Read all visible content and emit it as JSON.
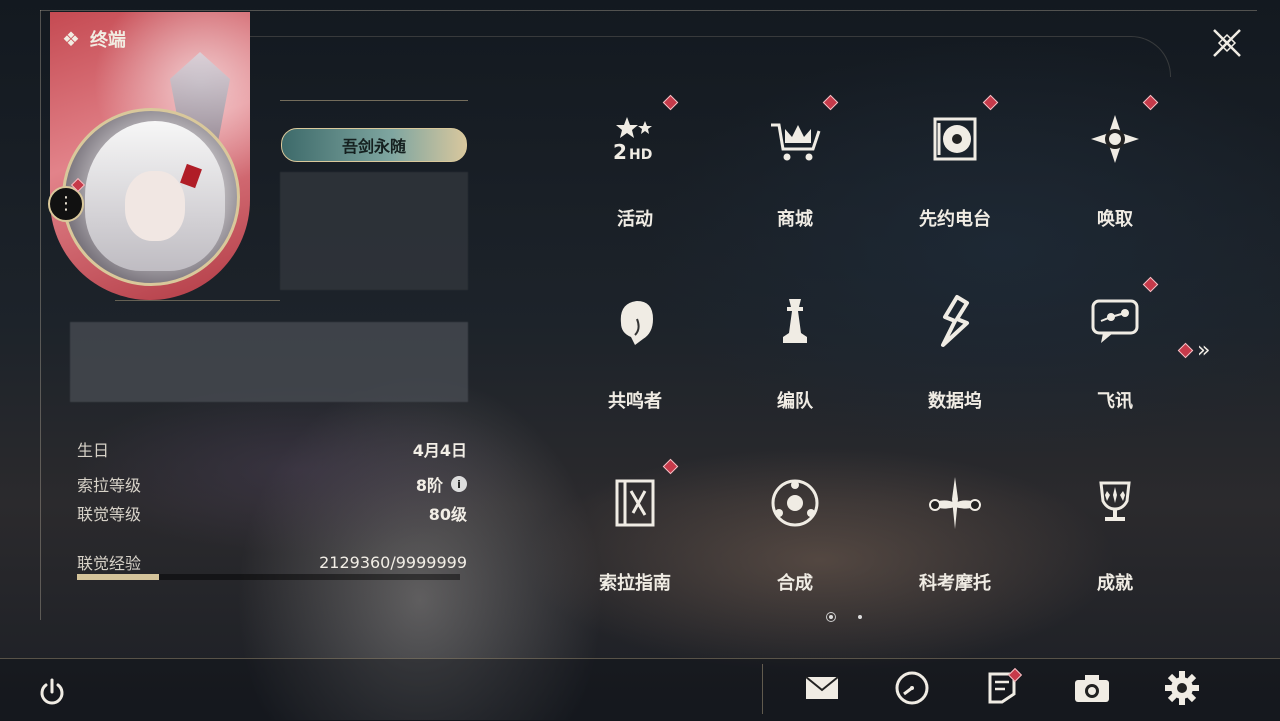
{
  "header": {
    "title": "终端"
  },
  "profile": {
    "title_badge": "吾剑永随"
  },
  "info": {
    "birthday": {
      "label": "生日",
      "value": "4月4日"
    },
    "sola_level": {
      "label": "索拉等级",
      "value": "8阶"
    },
    "union_level": {
      "label": "联觉等级",
      "value": "80级"
    },
    "union_exp": {
      "label": "联觉经验",
      "value": "2129360/9999999",
      "progress": 0.213
    }
  },
  "menu": [
    {
      "label": "活动",
      "icon": "event-2hd-icon",
      "badge": true
    },
    {
      "label": "商城",
      "icon": "shop-crown-cart-icon",
      "badge": true
    },
    {
      "label": "先约电台",
      "icon": "radio-vinyl-icon",
      "badge": true
    },
    {
      "label": "唤取",
      "icon": "summon-compass-icon",
      "badge": true
    },
    {
      "label": "共鸣者",
      "icon": "resonator-portrait-icon",
      "badge": false
    },
    {
      "label": "编队",
      "icon": "team-chess-icon",
      "badge": false
    },
    {
      "label": "数据坞",
      "icon": "data-bank-icon",
      "badge": false
    },
    {
      "label": "飞讯",
      "icon": "message-chat-icon",
      "badge": true
    },
    {
      "label": "索拉指南",
      "icon": "guide-book-icon",
      "badge": true
    },
    {
      "label": "合成",
      "icon": "synthesis-orb-icon",
      "badge": false
    },
    {
      "label": "科考摩托",
      "icon": "motorbike-icon",
      "badge": false
    },
    {
      "label": "成就",
      "icon": "achievement-trophy-icon",
      "badge": false
    }
  ],
  "pager": {
    "current": 1,
    "total": 2
  },
  "bottom": [
    {
      "icon": "mail-icon",
      "badge": false
    },
    {
      "icon": "clock-icon",
      "badge": false
    },
    {
      "icon": "notice-icon",
      "badge": true
    },
    {
      "icon": "camera-icon",
      "badge": false
    },
    {
      "icon": "settings-gear-icon",
      "badge": false
    }
  ],
  "colors": {
    "accent": "#d9c89b",
    "badge": "#c63a4a"
  }
}
